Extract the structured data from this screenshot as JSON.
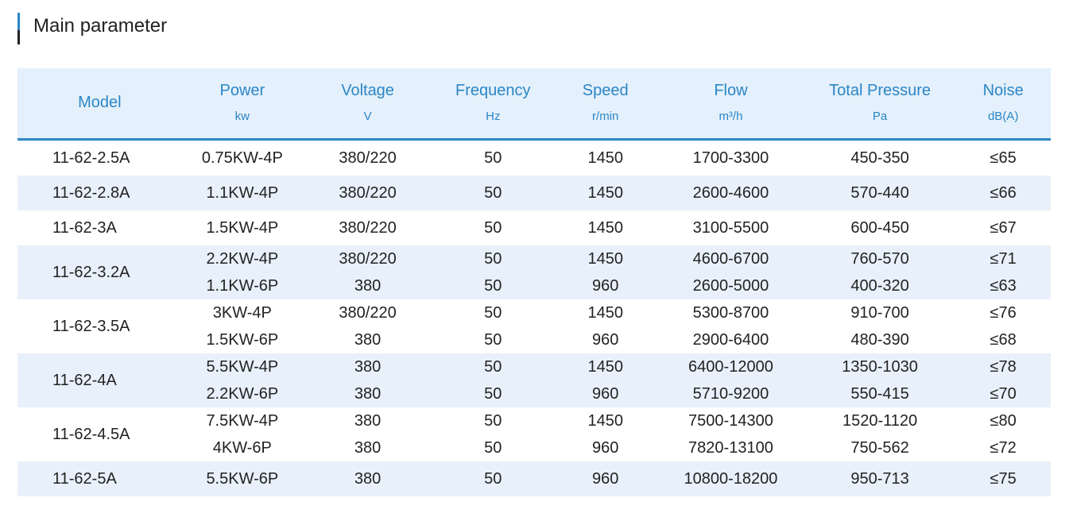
{
  "section": {
    "title": "Main parameter"
  },
  "table": {
    "headers": [
      {
        "label": "Model",
        "unit": ""
      },
      {
        "label": "Power",
        "unit": "kw"
      },
      {
        "label": "Voltage",
        "unit": "V"
      },
      {
        "label": "Frequency",
        "unit": "Hz"
      },
      {
        "label": "Speed",
        "unit": "r/min"
      },
      {
        "label": "Flow",
        "unit": "m³/h"
      },
      {
        "label": "Total Pressure",
        "unit": "Pa"
      },
      {
        "label": "Noise",
        "unit": "dB(A)"
      }
    ],
    "groups": [
      {
        "model": "11-62-2.5A",
        "rows": [
          {
            "power": "0.75KW-4P",
            "voltage": "380/220",
            "frequency": "50",
            "speed": "1450",
            "flow": "1700-3300",
            "pressure": "450-350",
            "noise": "≤65"
          }
        ]
      },
      {
        "model": "11-62-2.8A",
        "rows": [
          {
            "power": "1.1KW-4P",
            "voltage": "380/220",
            "frequency": "50",
            "speed": "1450",
            "flow": "2600-4600",
            "pressure": "570-440",
            "noise": "≤66"
          }
        ]
      },
      {
        "model": "11-62-3A",
        "rows": [
          {
            "power": "1.5KW-4P",
            "voltage": "380/220",
            "frequency": "50",
            "speed": "1450",
            "flow": "3100-5500",
            "pressure": "600-450",
            "noise": "≤67"
          }
        ]
      },
      {
        "model": "11-62-3.2A",
        "rows": [
          {
            "power": "2.2KW-4P",
            "voltage": "380/220",
            "frequency": "50",
            "speed": "1450",
            "flow": "4600-6700",
            "pressure": "760-570",
            "noise": "≤71"
          },
          {
            "power": "1.1KW-6P",
            "voltage": "380",
            "frequency": "50",
            "speed": "960",
            "flow": "2600-5000",
            "pressure": "400-320",
            "noise": "≤63"
          }
        ]
      },
      {
        "model": "11-62-3.5A",
        "rows": [
          {
            "power": "3KW-4P",
            "voltage": "380/220",
            "frequency": "50",
            "speed": "1450",
            "flow": "5300-8700",
            "pressure": "910-700",
            "noise": "≤76"
          },
          {
            "power": "1.5KW-6P",
            "voltage": "380",
            "frequency": "50",
            "speed": "960",
            "flow": "2900-6400",
            "pressure": "480-390",
            "noise": "≤68"
          }
        ]
      },
      {
        "model": "11-62-4A",
        "rows": [
          {
            "power": "5.5KW-4P",
            "voltage": "380",
            "frequency": "50",
            "speed": "1450",
            "flow": "6400-12000",
            "pressure": "1350-1030",
            "noise": "≤78"
          },
          {
            "power": "2.2KW-6P",
            "voltage": "380",
            "frequency": "50",
            "speed": "960",
            "flow": "5710-9200",
            "pressure": "550-415",
            "noise": "≤70"
          }
        ]
      },
      {
        "model": "11-62-4.5A",
        "rows": [
          {
            "power": "7.5KW-4P",
            "voltage": "380",
            "frequency": "50",
            "speed": "1450",
            "flow": "7500-14300",
            "pressure": "1520-1120",
            "noise": "≤80"
          },
          {
            "power": "4KW-6P",
            "voltage": "380",
            "frequency": "50",
            "speed": "960",
            "flow": "7820-13100",
            "pressure": "750-562",
            "noise": "≤72"
          }
        ]
      },
      {
        "model": "11-62-5A",
        "rows": [
          {
            "power": "5.5KW-6P",
            "voltage": "380",
            "frequency": "50",
            "speed": "960",
            "flow": "10800-18200",
            "pressure": "950-713",
            "noise": "≤75"
          }
        ]
      }
    ]
  }
}
